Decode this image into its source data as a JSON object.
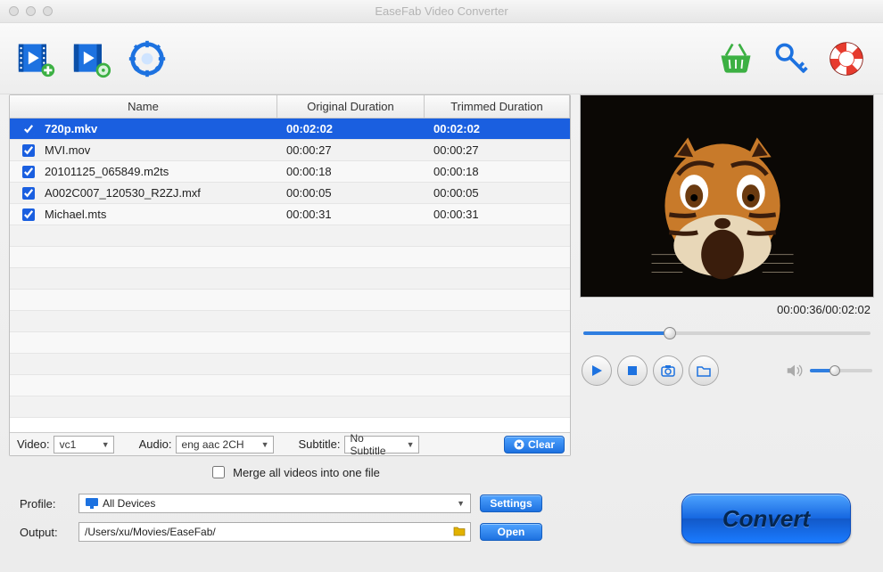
{
  "window": {
    "title": "EaseFab Video Converter"
  },
  "toolbar": {
    "add_video": "Add Video",
    "add_dvd": "Add DVD",
    "settings": "Settings",
    "buy": "Buy",
    "register": "Register",
    "help": "Help"
  },
  "table": {
    "headers": {
      "name": "Name",
      "original": "Original Duration",
      "trimmed": "Trimmed Duration"
    },
    "rows": [
      {
        "checked": true,
        "name": "720p.mkv",
        "odur": "00:02:02",
        "tdur": "00:02:02",
        "selected": true
      },
      {
        "checked": true,
        "name": "MVI.mov",
        "odur": "00:00:27",
        "tdur": "00:00:27",
        "selected": false
      },
      {
        "checked": true,
        "name": "20101125_065849.m2ts",
        "odur": "00:00:18",
        "tdur": "00:00:18",
        "selected": false
      },
      {
        "checked": true,
        "name": "A002C007_120530_R2ZJ.mxf",
        "odur": "00:00:05",
        "tdur": "00:00:05",
        "selected": false
      },
      {
        "checked": true,
        "name": "Michael.mts",
        "odur": "00:00:31",
        "tdur": "00:00:31",
        "selected": false
      }
    ]
  },
  "strip": {
    "video_label": "Video:",
    "video_value": "vc1",
    "audio_label": "Audio:",
    "audio_value": "eng aac 2CH",
    "subtitle_label": "Subtitle:",
    "subtitle_value": "No Subtitle",
    "clear_label": "Clear"
  },
  "preview": {
    "current_time": "00:00:36",
    "total_time": "00:02:02",
    "separator": "/",
    "seek_percent": 30,
    "volume_percent": 40
  },
  "merge": {
    "label": "Merge all videos into one file",
    "checked": false
  },
  "form": {
    "profile_label": "Profile:",
    "profile_value": "All Devices",
    "output_label": "Output:",
    "output_value": "/Users/xu/Movies/EaseFab/",
    "settings_btn": "Settings",
    "open_btn": "Open"
  },
  "convert_label": "Convert"
}
